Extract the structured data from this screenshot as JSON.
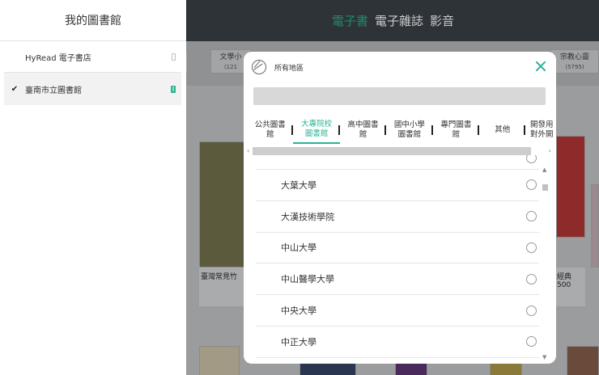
{
  "sidebar": {
    "title": "我的圖書館",
    "libraries": [
      {
        "check": "",
        "name": "HyRead 電子書店",
        "icon": "phone-outline-icon"
      },
      {
        "check": "✔",
        "name": "臺南市立圖書館",
        "icon": "phone-green-icon"
      }
    ]
  },
  "main": {
    "nav": [
      "電子書",
      "電子雜誌",
      "影音"
    ],
    "categories": [
      {
        "label": "文學小",
        "count": "(121"
      },
      {
        "label": "宗教心靈",
        "count": "(5795)"
      }
    ],
    "book_captions": [
      "臺灣常見竹",
      "經典500"
    ]
  },
  "modal": {
    "title": "所有地區",
    "search_placeholder": "",
    "tabs": [
      {
        "label": "公共圖書\n館"
      },
      {
        "label": "大專院校\n圖書館"
      },
      {
        "label": "高中圖書\n館"
      },
      {
        "label": "國中小學\n圖書館"
      },
      {
        "label": "專門圖書\n館"
      },
      {
        "label": "其他"
      },
      {
        "label": "開發用\n對外開"
      }
    ],
    "scroll_left": "‹",
    "scroll_right": "›",
    "universities": [
      {
        "name": "大葉大學"
      },
      {
        "name": "大漢技術學院"
      },
      {
        "name": "中山大學"
      },
      {
        "name": "中山醫學大學"
      },
      {
        "name": "中央大學"
      },
      {
        "name": "中正大學"
      }
    ]
  },
  "colors": {
    "accent": "#29b494",
    "nav_active": "#1f8a70"
  }
}
